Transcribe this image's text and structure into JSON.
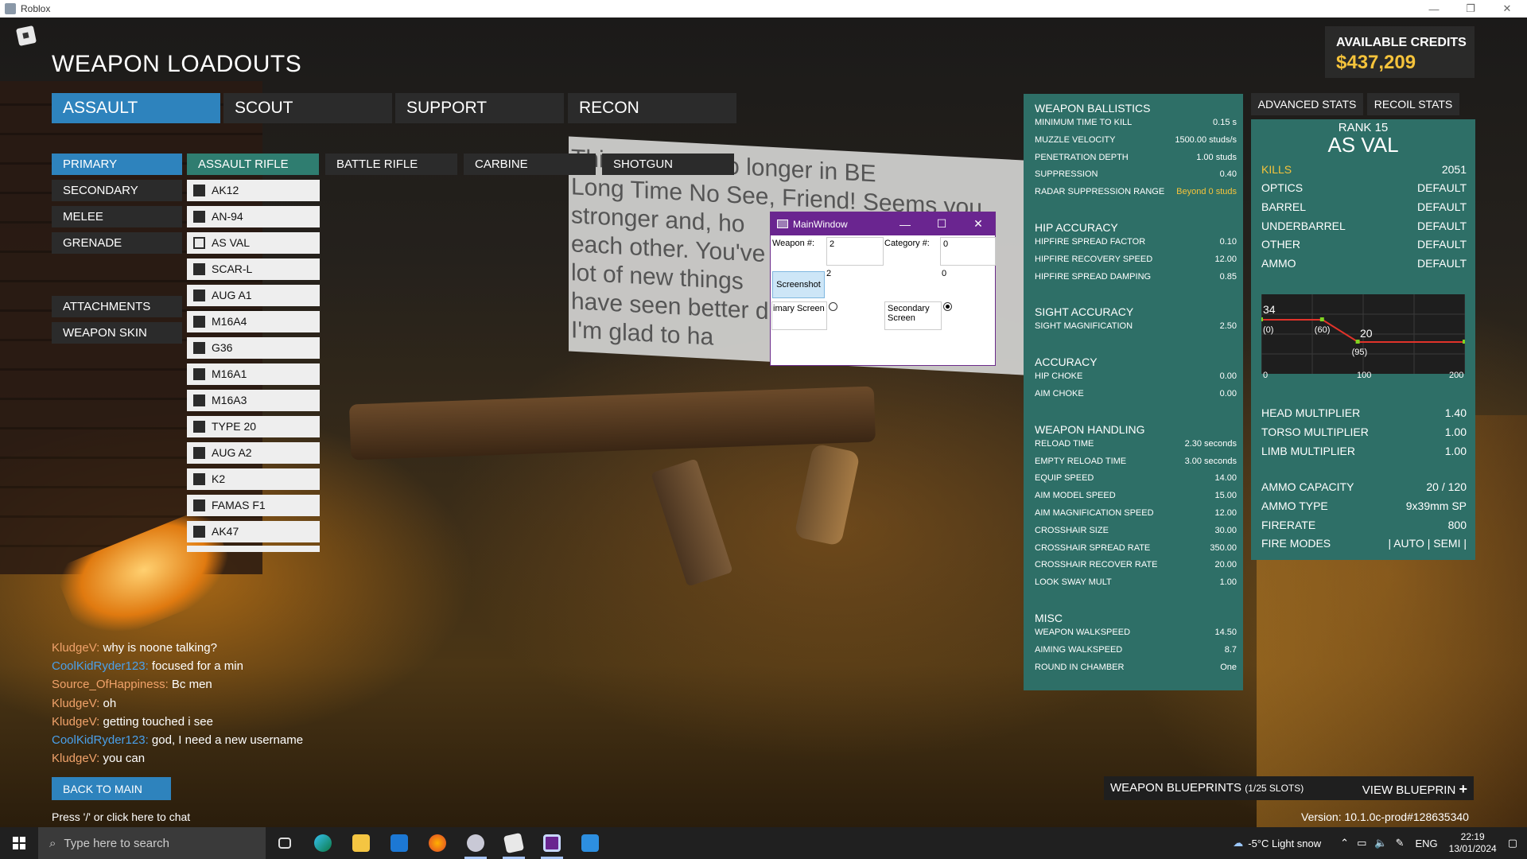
{
  "window": {
    "title": "Roblox",
    "minimize": "—",
    "restore": "❐",
    "close": "✕"
  },
  "poster_text": "This game is no longer in BE\nLong Time No See, Friend! Seems you\nstronger and, ho\neach other. You've\nlot of new things\nhave seen better d\nI'm glad to ha",
  "page_title": "WEAPON LOADOUTS",
  "credits": {
    "label": "AVAILABLE CREDITS",
    "amount": "$437,209"
  },
  "class_tabs": [
    "ASSAULT",
    "SCOUT",
    "SUPPORT",
    "RECON"
  ],
  "slots": [
    "PRIMARY",
    "SECONDARY",
    "MELEE",
    "GRENADE"
  ],
  "slot_extra": [
    "ATTACHMENTS",
    "WEAPON SKIN"
  ],
  "weapon_types": [
    "ASSAULT RIFLE",
    "BATTLE RIFLE",
    "CARBINE",
    "SHOTGUN"
  ],
  "weapons": [
    "AK12",
    "AN-94",
    "AS VAL",
    "SCAR-L",
    "AUG A1",
    "M16A4",
    "G36",
    "M16A1",
    "M16A3",
    "TYPE 20",
    "AUG A2",
    "K2",
    "FAMAS F1",
    "AK47"
  ],
  "selected_weapon_index": 2,
  "dialog": {
    "title": "MainWindow",
    "weapon_label": "Weapon #:",
    "weapon_value": "2",
    "category_label": "Category #:",
    "category_value": "0",
    "weapon_value2": "2",
    "category_value2": "0",
    "screenshot_btn": "Screenshot",
    "primary_label": "imary Screen",
    "secondary_label": "Secondary Screen",
    "selected_screen": "secondary"
  },
  "ballistics": {
    "sections": [
      {
        "title": "WEAPON BALLISTICS",
        "rows": [
          [
            "MINIMUM TIME TO KILL",
            "0.15 s"
          ],
          [
            "MUZZLE VELOCITY",
            "1500.00 studs/s"
          ],
          [
            "PENETRATION DEPTH",
            "1.00 studs"
          ],
          [
            "SUPPRESSION",
            "0.40"
          ],
          [
            "RADAR SUPPRESSION RANGE",
            "Beyond 0 studs"
          ]
        ]
      },
      {
        "title": "HIP ACCURACY",
        "rows": [
          [
            "HIPFIRE SPREAD FACTOR",
            "0.10"
          ],
          [
            "HIPFIRE RECOVERY SPEED",
            "12.00"
          ],
          [
            "HIPFIRE SPREAD DAMPING",
            "0.85"
          ]
        ]
      },
      {
        "title": "SIGHT ACCURACY",
        "rows": [
          [
            "SIGHT MAGNIFICATION",
            "2.50"
          ]
        ]
      },
      {
        "title": "ACCURACY",
        "rows": [
          [
            "HIP CHOKE",
            "0.00"
          ],
          [
            "AIM CHOKE",
            "0.00"
          ]
        ]
      },
      {
        "title": "WEAPON HANDLING",
        "rows": [
          [
            "RELOAD TIME",
            "2.30 seconds"
          ],
          [
            "EMPTY RELOAD TIME",
            "3.00 seconds"
          ],
          [
            "EQUIP SPEED",
            "14.00"
          ],
          [
            "AIM MODEL SPEED",
            "15.00"
          ],
          [
            "AIM MAGNIFICATION SPEED",
            "12.00"
          ],
          [
            "CROSSHAIR SIZE",
            "30.00"
          ],
          [
            "CROSSHAIR SPREAD RATE",
            "350.00"
          ],
          [
            "CROSSHAIR RECOVER RATE",
            "20.00"
          ],
          [
            "LOOK SWAY MULT",
            "1.00"
          ]
        ]
      },
      {
        "title": "MISC",
        "rows": [
          [
            "WEAPON WALKSPEED",
            "14.50"
          ],
          [
            "AIMING WALKSPEED",
            "8.7"
          ],
          [
            "ROUND IN CHAMBER",
            "One"
          ]
        ]
      }
    ]
  },
  "right_tabs": [
    "ADVANCED STATS",
    "RECOIL STATS"
  ],
  "weapon_panel": {
    "rank": "RANK 15",
    "name": "AS VAL",
    "kills_label": "KILLS",
    "kills": "2051",
    "attachments": [
      [
        "OPTICS",
        "DEFAULT"
      ],
      [
        "BARREL",
        "DEFAULT"
      ],
      [
        "UNDERBARREL",
        "DEFAULT"
      ],
      [
        "OTHER",
        "DEFAULT"
      ],
      [
        "AMMO",
        "DEFAULT"
      ]
    ],
    "multipliers": [
      [
        "HEAD MULTIPLIER",
        "1.40"
      ],
      [
        "TORSO MULTIPLIER",
        "1.00"
      ],
      [
        "LIMB MULTIPLIER",
        "1.00"
      ]
    ],
    "ammo": [
      [
        "AMMO CAPACITY",
        "20 / 120"
      ],
      [
        "AMMO TYPE",
        "9x39mm SP"
      ],
      [
        "FIRERATE",
        "800"
      ],
      [
        "FIRE MODES",
        "|  AUTO  |  SEMI  |"
      ]
    ]
  },
  "chart_data": {
    "type": "line",
    "x_ticks": [
      "0",
      "100",
      "200"
    ],
    "xlim": [
      0,
      200
    ],
    "ylim": [
      0,
      50
    ],
    "series": [
      {
        "values": [
          [
            0,
            34
          ],
          [
            60,
            34
          ],
          [
            95,
            20
          ],
          [
            200,
            20
          ]
        ]
      }
    ],
    "annotations": [
      "34",
      "20",
      "(0)",
      "(60)",
      "(95)"
    ],
    "colors": {
      "line": "#e0332a",
      "marker": "#7ed321",
      "background": "#1e1e1e"
    }
  },
  "chat": [
    {
      "name": "KludgeV:",
      "msg": " why is noone talking?",
      "color": "n1"
    },
    {
      "name": "CoolKidRyder123:",
      "msg": " focused for a min",
      "color": "n2"
    },
    {
      "name": "Source_OfHappiness:",
      "msg": " Bc men",
      "color": "n3"
    },
    {
      "name": "KludgeV:",
      "msg": " oh",
      "color": "n1"
    },
    {
      "name": "KludgeV:",
      "msg": " getting touched i see",
      "color": "n1"
    },
    {
      "name": "CoolKidRyder123:",
      "msg": " god, I need a new username",
      "color": "n2"
    },
    {
      "name": "KludgeV:",
      "msg": " you can",
      "color": "n1"
    }
  ],
  "back_button": "BACK TO MAIN",
  "chat_hint": "Press '/' or click here to chat",
  "blueprints": {
    "label": "WEAPON BLUEPRINTS",
    "slots": "(1/25 SLOTS)",
    "view": "VIEW BLUEPRIN",
    "view_icon": "+"
  },
  "version": "Version: 10.1.0c-prod#128635340",
  "taskbar": {
    "search_placeholder": "Type here to search",
    "weather": "-5°C  Light snow",
    "lang": "ENG",
    "time": "22:19",
    "date": "13/01/2024"
  }
}
